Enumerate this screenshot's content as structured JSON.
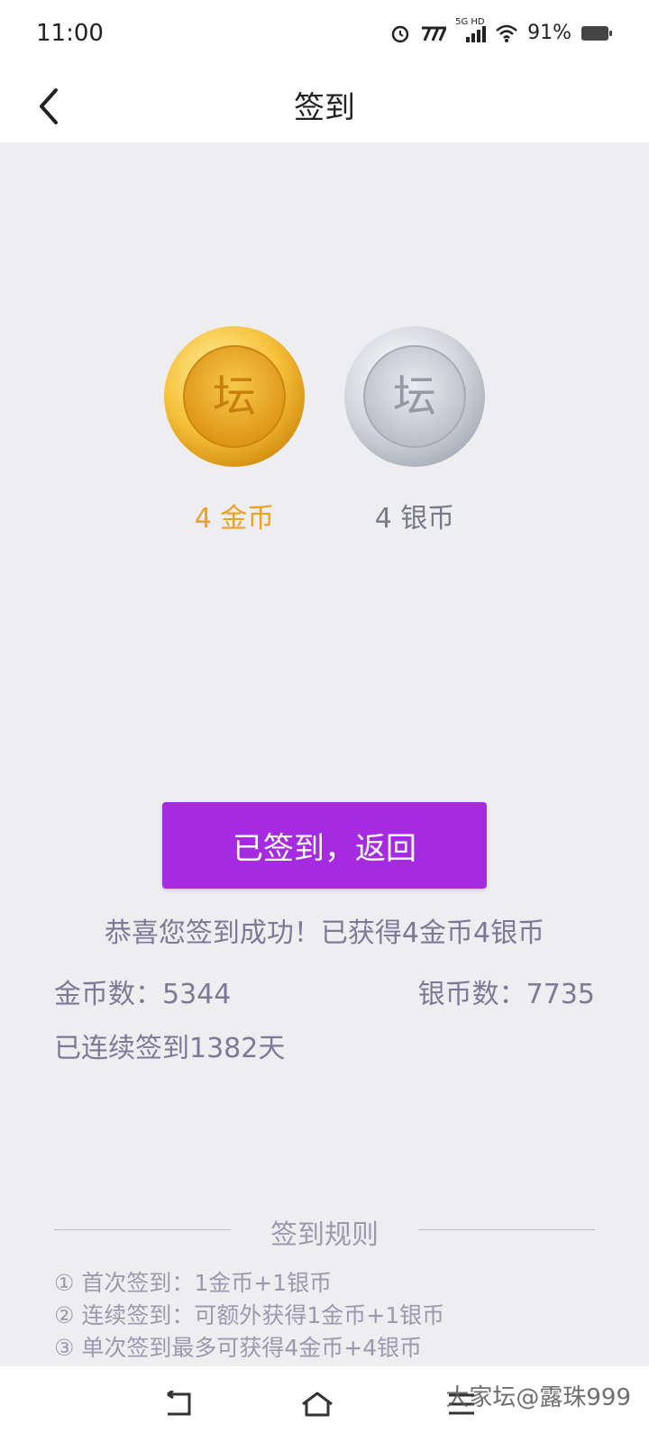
{
  "status_bar": {
    "time": "11:00",
    "network": "5G HD",
    "battery": "91%",
    "icons": [
      "alarm-icon",
      "carrier-icon",
      "signal-icon",
      "wifi-icon",
      "battery-icon"
    ]
  },
  "header": {
    "title": "签到",
    "back_icon": "chevron-left-icon"
  },
  "rewards": {
    "gold_label": "4 金币",
    "silver_label": "4 银币",
    "coin_char": "坛",
    "gold_color": "#f0a020",
    "silver_color": "#777a88"
  },
  "primary_button": {
    "label": "已签到，返回",
    "color": "#a52ae0"
  },
  "result": {
    "success_message": "恭喜您签到成功！已获得4金币4银币",
    "gold_count": "金币数：5344",
    "silver_count": "银币数：7735",
    "streak": "已连续签到1382天"
  },
  "rules": {
    "title": "签到规则",
    "items": [
      "① 首次签到：1金币+1银币",
      "② 连续签到：可额外获得1金币+1银币",
      "③ 单次签到最多可获得4金币+4银币"
    ]
  },
  "system_nav": {
    "icons": [
      "back-icon",
      "home-icon",
      "menu-icon"
    ]
  },
  "watermark": "大家坛@露珠999"
}
